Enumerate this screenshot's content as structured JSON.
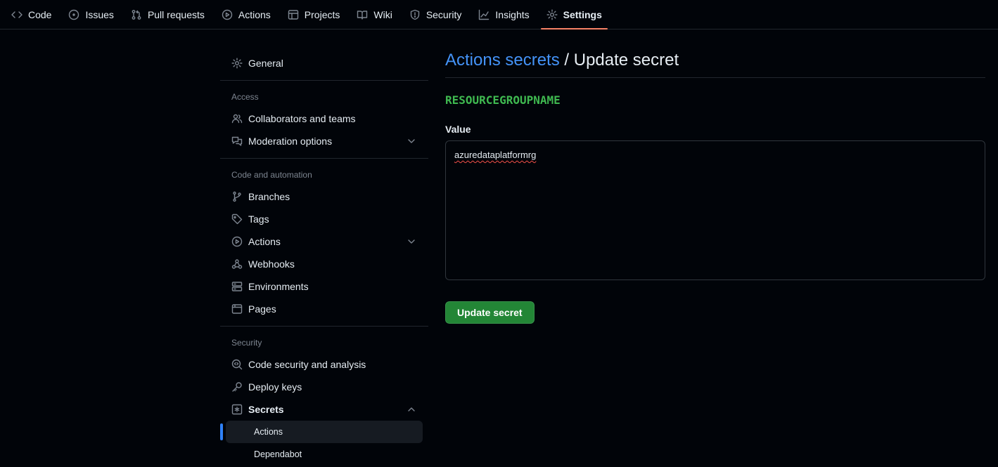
{
  "nav": {
    "tabs": [
      {
        "label": "Code",
        "icon": "code-icon"
      },
      {
        "label": "Issues",
        "icon": "issue-icon"
      },
      {
        "label": "Pull requests",
        "icon": "pull-request-icon"
      },
      {
        "label": "Actions",
        "icon": "play-icon"
      },
      {
        "label": "Projects",
        "icon": "table-icon"
      },
      {
        "label": "Wiki",
        "icon": "book-icon"
      },
      {
        "label": "Security",
        "icon": "shield-icon"
      },
      {
        "label": "Insights",
        "icon": "graph-icon"
      },
      {
        "label": "Settings",
        "icon": "gear-icon",
        "active": true
      }
    ]
  },
  "sidebar": {
    "general": "General",
    "access_heading": "Access",
    "collaborators": "Collaborators and teams",
    "moderation": "Moderation options",
    "code_heading": "Code and automation",
    "branches": "Branches",
    "tags": "Tags",
    "actions": "Actions",
    "webhooks": "Webhooks",
    "environments": "Environments",
    "pages": "Pages",
    "security_heading": "Security",
    "code_security": "Code security and analysis",
    "deploy_keys": "Deploy keys",
    "secrets": "Secrets",
    "secrets_actions": "Actions",
    "secrets_dependabot": "Dependabot"
  },
  "main": {
    "breadcrumb_link": "Actions secrets",
    "breadcrumb_sep": " / ",
    "title": "Update secret",
    "secret_name": "RESOURCEGROUPNAME",
    "value_label": "Value",
    "value": "azuredataplatformrg",
    "submit_label": "Update secret"
  },
  "colors": {
    "accent_tab_underline": "#f78166",
    "link": "#4493f8",
    "secret_name": "#3fb950",
    "button": "#238636",
    "selected_marker": "#2f81f7"
  }
}
